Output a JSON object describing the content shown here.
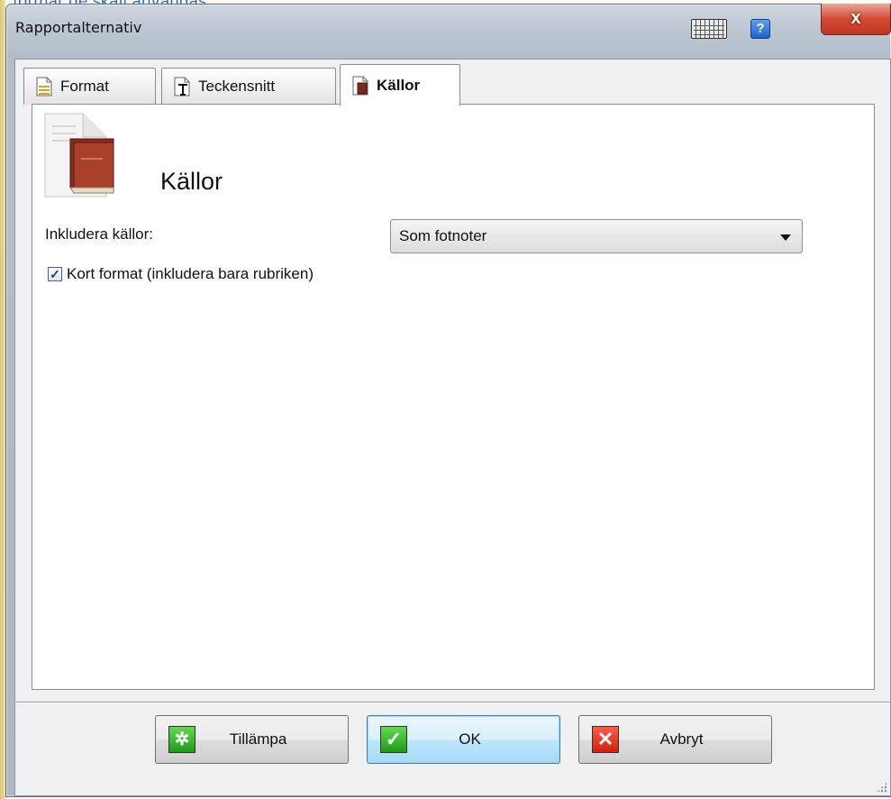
{
  "background": {
    "text": "format de skall användas."
  },
  "window": {
    "title": "Rapportalternativ",
    "close_label": "x",
    "help_label": "?"
  },
  "tabs": [
    {
      "label": "Format",
      "icon": "format-icon"
    },
    {
      "label": "Teckensnitt",
      "icon": "font-icon"
    },
    {
      "label": "Källor",
      "icon": "sources-icon",
      "active": true
    }
  ],
  "panel": {
    "title": "Källor",
    "include_label": "Inkludera källor:",
    "include_select_value": "Som fotnoter",
    "short_format_label": "Kort format (inkludera bara rubriken)",
    "short_format_checked": true
  },
  "buttons": {
    "apply": "Tillämpa",
    "ok": "OK",
    "cancel": "Avbryt"
  },
  "colors": {
    "accent": "#3c7fb1",
    "close": "#c23620"
  }
}
